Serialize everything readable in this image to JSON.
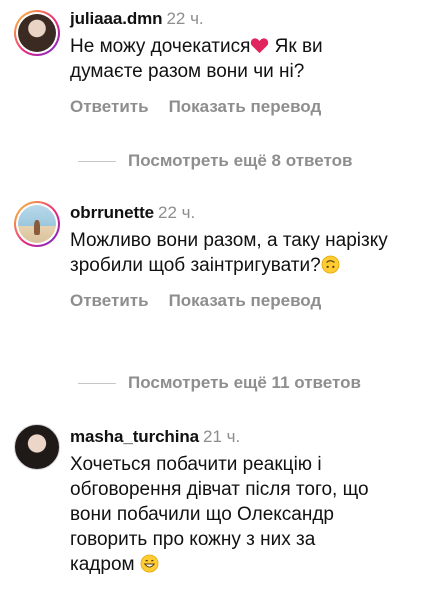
{
  "comments": [
    {
      "username": "juliaaa.dmn",
      "time": "22 ч.",
      "text_before_emoji": "Не можу дочекатися",
      "text_after_emoji": " Як ви думаєте разом вони чи ні?",
      "emoji": "red-heart-emoji",
      "reply_label": "Ответить",
      "translate_label": "Показать перевод",
      "view_replies": "Посмотреть ещё 8 ответов",
      "has_story_ring": true
    },
    {
      "username": "obrrunette",
      "time": "22 ч.",
      "text_before_emoji": "Можливо вони разом, а таку нарізку зробили щоб заінтригувати?",
      "text_after_emoji": "",
      "emoji": "upside-down-face-emoji",
      "reply_label": "Ответить",
      "translate_label": "Показать перевод",
      "view_replies": "Посмотреть ещё 11 ответов",
      "has_story_ring": true
    },
    {
      "username": "masha_turchina",
      "time": "21 ч.",
      "text_before_emoji": "Хочеться побачити реакцію і обговорення дівчат після того, що вони побачили що Олександр говорить про кожну з них за кадром ",
      "text_after_emoji": "",
      "emoji": "grinning-face-emoji",
      "has_story_ring": false
    }
  ],
  "colors": {
    "text": "#111111",
    "secondary": "#8e8e8e",
    "heart": "#e0245e",
    "emoji_yellow": "#ffcc33"
  }
}
